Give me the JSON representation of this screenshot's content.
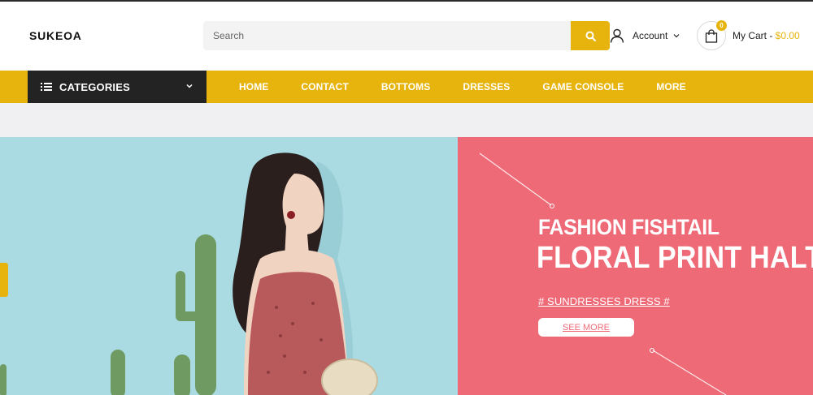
{
  "colors": {
    "accent": "#e6b40c",
    "dark": "#232323",
    "hero_left_bg": "#aadbe3",
    "hero_right_bg": "#ee6a77"
  },
  "header": {
    "logo": "SUKEOA",
    "search": {
      "placeholder": "Search",
      "icon": "search-icon"
    },
    "account": {
      "label": "Account",
      "icon": "user-icon"
    },
    "cart": {
      "label": "My Cart - ",
      "total": "$0.00",
      "count": "0",
      "icon": "shopping-bag-icon"
    }
  },
  "nav": {
    "categories_label": "CATEGORIES",
    "items": [
      "HOME",
      "CONTACT",
      "BOTTOMS",
      "DRESSES",
      "GAME CONSOLE",
      "MORE"
    ]
  },
  "hero": {
    "line1": "FASHION FISHTAIL",
    "line2": "FLORAL PRINT HALTER",
    "tag": "# SUNDRESSES DRESS #",
    "button": "SEE MORE"
  }
}
